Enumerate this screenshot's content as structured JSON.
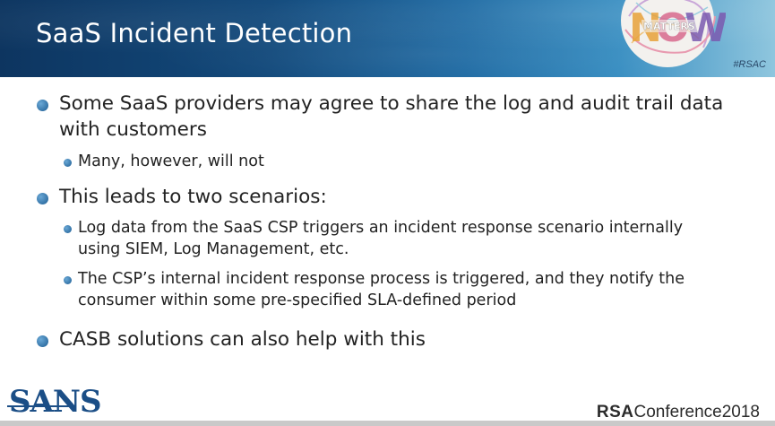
{
  "slide": {
    "title": "SaaS Incident Detection",
    "hashtag": "#RSAC",
    "badge_text": "MATTERS",
    "bullets": [
      {
        "text_line1": "Some SaaS providers may agree to share the log and audit trail data",
        "text_line2": "with customers"
      },
      {
        "sub": "Many, however, will not"
      },
      {
        "text": "This leads to two scenarios:"
      },
      {
        "sub_line1": "Log data from the SaaS CSP triggers an incident response scenario internally",
        "sub_line2": "using SIEM, Log Management, etc."
      },
      {
        "sub_line1": "The CSP’s internal incident response process is triggered, and they notify the",
        "sub_line2": "consumer within some pre-specified SLA-defined period"
      },
      {
        "text": "CASB solutions can also help with this"
      }
    ]
  },
  "footer": {
    "sans_logo": "SANS",
    "conference_rsa": "RSA",
    "conference_text": "Conference2018"
  },
  "colors": {
    "header_dark": "#0d3560",
    "bullet_blue": "#1d5d93",
    "text": "#222222"
  }
}
